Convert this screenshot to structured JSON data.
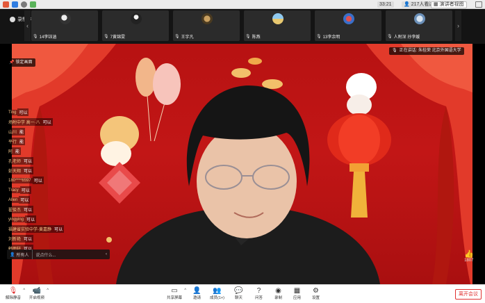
{
  "topbar": {
    "time": "33:21",
    "viewers": "217人看过",
    "view_mode": "演讲者视图"
  },
  "strip": {
    "record_label": "录制中",
    "prev_arrow": "‹",
    "next_arrow": "›",
    "thumbnails": [
      {
        "name": "14李钰涵"
      },
      {
        "name": "7黄锦雯"
      },
      {
        "name": "王宇凡"
      },
      {
        "name": "陈燕"
      },
      {
        "name": "13李余明"
      },
      {
        "name": "人附深 孙李媛"
      }
    ]
  },
  "video": {
    "pin_label": "锁定画面",
    "speaker_label": "正在讲话: 朱桂荣 北京外国语大学",
    "likes": "1807"
  },
  "chat": {
    "messages": [
      {
        "user": "Ting",
        "text": "可以"
      },
      {
        "user": "场附中学 高一·八",
        "text": "可以"
      },
      {
        "user": "山川",
        "text": "能"
      },
      {
        "user": "平行",
        "text": "能"
      },
      {
        "user": "阿",
        "text": "能"
      },
      {
        "user": "孔老师",
        "text": "可以"
      },
      {
        "user": "彭天翔",
        "text": "可以"
      },
      {
        "user": "180****6597",
        "text": "可以"
      },
      {
        "user": "Tracy",
        "text": "可以"
      },
      {
        "user": "Allen",
        "text": "可以"
      },
      {
        "user": "翟俊杰",
        "text": "可以"
      },
      {
        "user": "yingying",
        "text": "可以"
      },
      {
        "user": "福建省实验中学-黄嘉静",
        "text": "可以"
      },
      {
        "user": "刘新艳",
        "text": "可以"
      },
      {
        "user": "韩雨轩",
        "text": "可以"
      }
    ],
    "recipient": "所有人",
    "placeholder": "说点什么...",
    "send": "‹"
  },
  "toolbar": {
    "tools": [
      {
        "label": "解除静音",
        "icon": "mic-off"
      },
      {
        "label": "开启视频",
        "icon": "video-off"
      },
      {
        "label": "共享屏幕",
        "icon": "share-screen"
      },
      {
        "label": "邀请",
        "icon": "invite"
      },
      {
        "label": "成员(1+)",
        "icon": "members"
      },
      {
        "label": "聊天",
        "icon": "chat"
      },
      {
        "label": "问答",
        "icon": "qa"
      },
      {
        "label": "录制",
        "icon": "record"
      },
      {
        "label": "应用",
        "icon": "apps"
      },
      {
        "label": "设置",
        "icon": "settings"
      }
    ],
    "leave": "离开会议"
  },
  "colors": {
    "accent_red": "#e03030",
    "background_red": "#c21616"
  }
}
